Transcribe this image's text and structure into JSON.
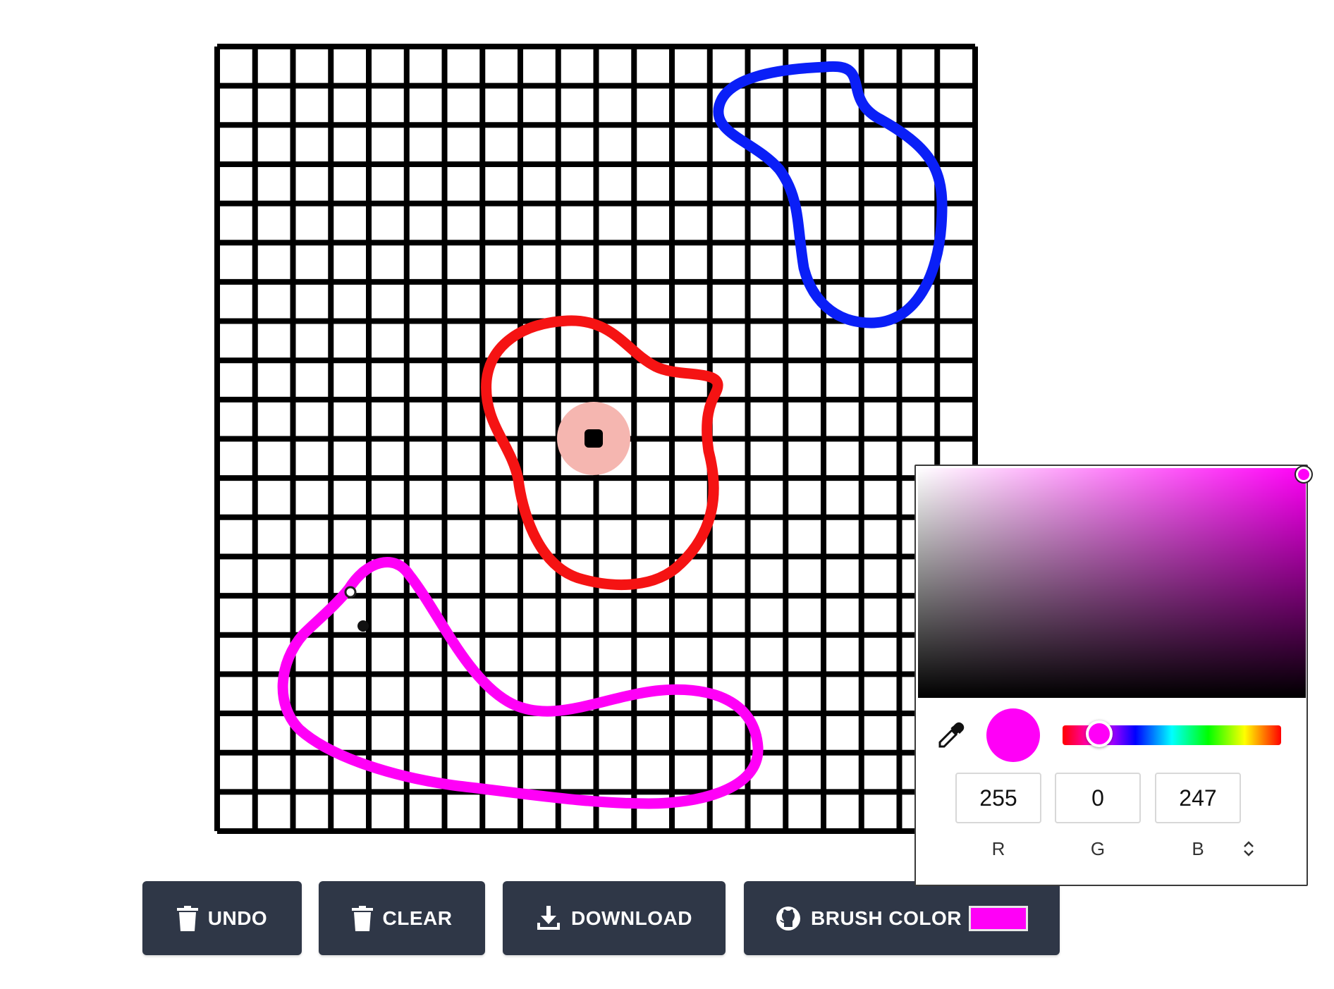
{
  "toolbar": {
    "undo_label": "UNDO",
    "clear_label": "CLEAR",
    "download_label": "DOWNLOAD",
    "brush_color_label": "BRUSH COLOR",
    "brush_swatch_color": "#ff00f7"
  },
  "color_picker": {
    "selected_color": "#ff00f7",
    "hue_color": "#ff00f7",
    "r": "255",
    "g": "0",
    "b": "247",
    "r_label": "R",
    "g_label": "G",
    "b_label": "B",
    "mode": "RGB"
  },
  "drawing": {
    "grid_columns": 20,
    "grid_rows": 20,
    "stroke_colors": [
      "#0a1ff7",
      "#f51313",
      "#ff00f7"
    ],
    "cursor_color": "#f5b6b0"
  },
  "icons": {
    "undo": "trash-icon",
    "clear": "trash-icon",
    "download": "download-icon",
    "brush": "github-icon",
    "picker": "eyedropper-icon",
    "mode": "chevron-updown-icon"
  }
}
